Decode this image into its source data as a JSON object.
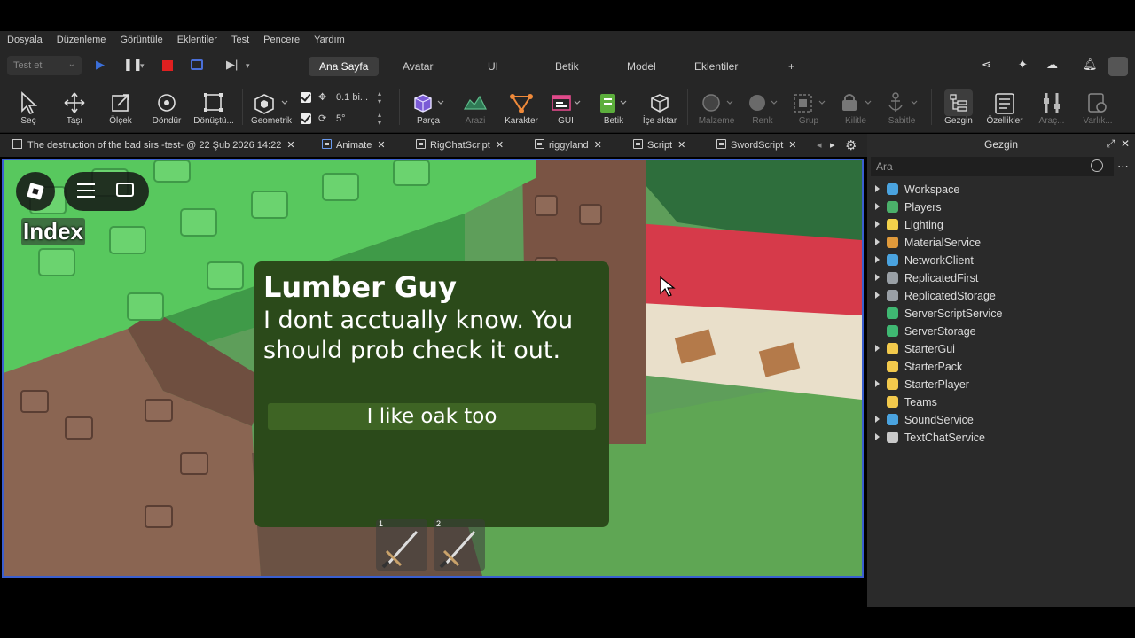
{
  "menu": [
    "Dosyala",
    "Düzenleme",
    "Görüntüle",
    "Eklentiler",
    "Test",
    "Pencere",
    "Yardım"
  ],
  "topbar": {
    "test_select": "Test et",
    "tabs": [
      "Ana Sayfa",
      "Avatar",
      "UI",
      "Betik",
      "Model",
      "Eklentiler",
      "+"
    ],
    "active_tab": "Ana Sayfa"
  },
  "toolbar": {
    "tools": [
      {
        "label": "Seç",
        "icon": "cursor-icon"
      },
      {
        "label": "Taşı",
        "icon": "move-icon"
      },
      {
        "label": "Ölçek",
        "icon": "scale-icon"
      },
      {
        "label": "Döndür",
        "icon": "rotate-icon"
      },
      {
        "label": "Dönüştü...",
        "icon": "transform-icon"
      },
      {
        "label": "Geometrik",
        "icon": "geometric-icon"
      },
      {
        "label": "Parça",
        "icon": "part-icon"
      },
      {
        "label": "Arazi",
        "icon": "terrain-icon"
      },
      {
        "label": "Karakter",
        "icon": "character-icon"
      },
      {
        "label": "GUI",
        "icon": "gui-icon"
      },
      {
        "label": "Betik",
        "icon": "script-icon"
      },
      {
        "label": "İçe aktar",
        "icon": "import-icon"
      },
      {
        "label": "Malzeme",
        "icon": "material-icon"
      },
      {
        "label": "Renk",
        "icon": "color-icon"
      },
      {
        "label": "Grup",
        "icon": "group-icon"
      },
      {
        "label": "Kilitle",
        "icon": "lock-icon"
      },
      {
        "label": "Sabitle",
        "icon": "anchor-icon"
      },
      {
        "label": "Gezgin",
        "icon": "explorer-icon"
      },
      {
        "label": "Özellikler",
        "icon": "properties-icon"
      },
      {
        "label": "Araç...",
        "icon": "tools-icon"
      },
      {
        "label": "Varlık...",
        "icon": "assets-icon"
      }
    ],
    "move_snap": "0.1 bi...",
    "rotate_snap": "5°"
  },
  "doc_tabs": [
    {
      "label": "The destruction of the bad sirs -test- @ 22 Şub 2026 14:22",
      "icon": "studio-icon"
    },
    {
      "label": "Animate",
      "icon": "script-icon"
    },
    {
      "label": "RigChatScript",
      "icon": "script-icon"
    },
    {
      "label": "riggyland",
      "icon": "script-icon"
    },
    {
      "label": "Script",
      "icon": "script-icon"
    },
    {
      "label": "SwordScript",
      "icon": "script-icon"
    }
  ],
  "game": {
    "index_label": "Index",
    "dialog": {
      "name": "Lumber Guy",
      "text": "I dont acctually know. You should prob check it out.",
      "choice": "I like oak too"
    },
    "hotbar": [
      {
        "num": "1"
      },
      {
        "num": "2"
      }
    ]
  },
  "explorer": {
    "title": "Gezgin",
    "search_placeholder": "Ara",
    "items": [
      {
        "name": "Workspace",
        "expandable": true,
        "color": "#4aa3df"
      },
      {
        "name": "Players",
        "expandable": true,
        "color": "#4bb06a"
      },
      {
        "name": "Lighting",
        "expandable": true,
        "color": "#f2d24b"
      },
      {
        "name": "MaterialService",
        "expandable": true,
        "color": "#e09a3b"
      },
      {
        "name": "NetworkClient",
        "expandable": true,
        "color": "#4aa3df"
      },
      {
        "name": "ReplicatedFirst",
        "expandable": true,
        "color": "#9aa0a6"
      },
      {
        "name": "ReplicatedStorage",
        "expandable": true,
        "color": "#9aa0a6"
      },
      {
        "name": "ServerScriptService",
        "expandable": false,
        "color": "#3fb872"
      },
      {
        "name": "ServerStorage",
        "expandable": false,
        "color": "#3fb872"
      },
      {
        "name": "StarterGui",
        "expandable": true,
        "color": "#f2c94c"
      },
      {
        "name": "StarterPack",
        "expandable": false,
        "color": "#f2c94c"
      },
      {
        "name": "StarterPlayer",
        "expandable": true,
        "color": "#f2c94c"
      },
      {
        "name": "Teams",
        "expandable": false,
        "color": "#f2c94c"
      },
      {
        "name": "SoundService",
        "expandable": true,
        "color": "#4aa3df"
      },
      {
        "name": "TextChatService",
        "expandable": true,
        "color": "#c9c9c9"
      }
    ]
  }
}
